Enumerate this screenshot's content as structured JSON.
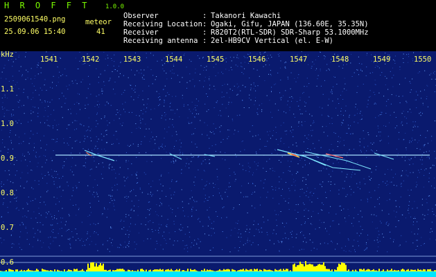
{
  "header": {
    "app_title": "H R O F F T",
    "app_version": "1.0.0",
    "filename": "2509061540.png",
    "datetime": "25.09.06 15:40",
    "meteor_label": "meteor",
    "meteor_count": "41"
  },
  "info": [
    {
      "label": "Observer",
      "sep": ":",
      "value": "Takanori Kawachi"
    },
    {
      "label": "Receiving Location",
      "sep": ":",
      "value": "Ogaki, Gifu, JAPAN (136.60E, 35.35N)"
    },
    {
      "label": "Receiver",
      "sep": ":",
      "value": "R820T2(RTL-SDR) SDR-Sharp 53.1000MHz"
    },
    {
      "label": "Receiving antenna",
      "sep": ":",
      "value": "2el-HB9CV Vertical (el. E-W)"
    }
  ],
  "axis": {
    "y_unit": "kHz",
    "x_ticks": [
      "1541",
      "1542",
      "1543",
      "1544",
      "1545",
      "1546",
      "1547",
      "1548",
      "1549",
      "1550"
    ],
    "y_ticks": [
      "1.1",
      "1.0",
      "0.9",
      "0.8",
      "0.7",
      "0.6"
    ]
  },
  "colors": {
    "background": "#0a1a6e",
    "carrier": "#a8e0ff",
    "accent_green": "#7CFC00",
    "label_yellow": "#ffff66",
    "activity_yellow": "#ffff00",
    "activity_cyan": "#00e5ff"
  }
}
